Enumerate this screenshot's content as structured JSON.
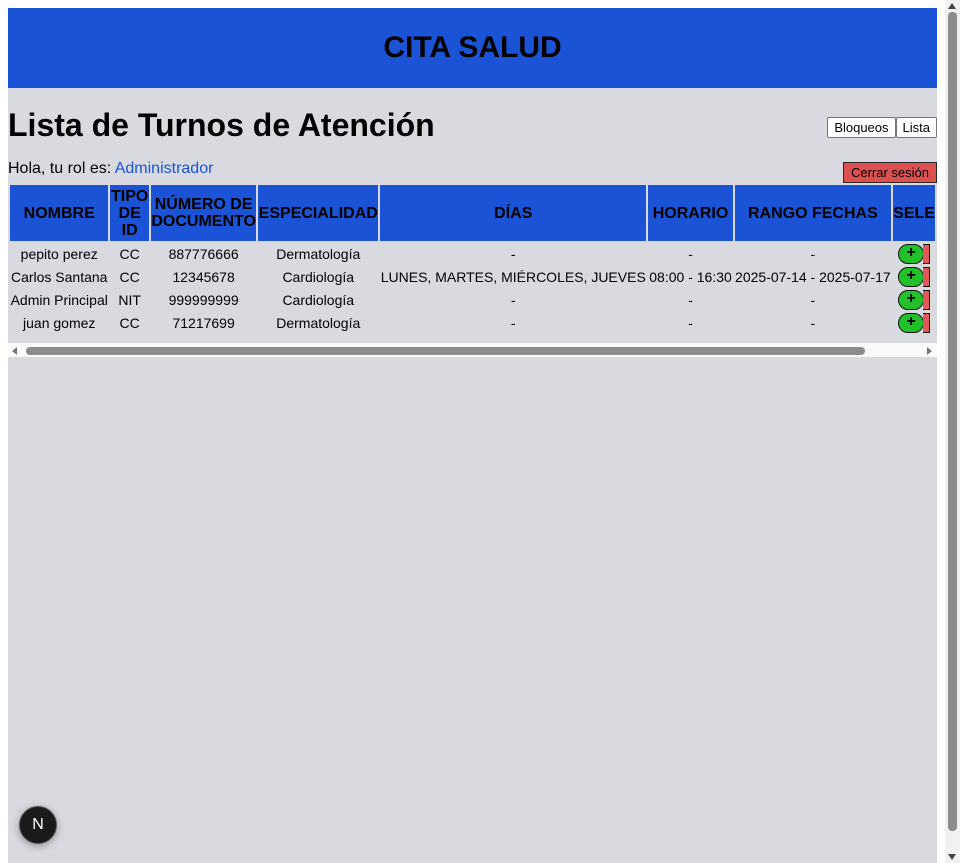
{
  "app": {
    "title": "CITA SALUD"
  },
  "page": {
    "heading": "Lista de Turnos de Atención"
  },
  "nav": {
    "blocks_label": "Bloqueos",
    "list_label": "Lista"
  },
  "user": {
    "greeting": "Hola, tu rol es:",
    "role": "Administrador",
    "logout_label": "Cerrar sesión"
  },
  "table": {
    "headers": {
      "name": "NOMBRE",
      "id_type_l1": "TIPO",
      "id_type_l2": "DE",
      "id_type_l3": "ID",
      "doc_l1": "NÚMERO DE",
      "doc_l2": "DOCUMENTO",
      "specialty": "ESPECIALIDAD",
      "days": "DÍAS",
      "schedule": "HORARIO",
      "date_range": "RANGO FECHAS",
      "select": "SELE"
    },
    "rows": [
      {
        "name": "pepito perez",
        "id_type": "CC",
        "document": "887776666",
        "specialty": "Dermatología",
        "days": "-",
        "schedule": "-",
        "date_range": "-",
        "action": "+"
      },
      {
        "name": "Carlos Santana",
        "id_type": "CC",
        "document": "12345678",
        "specialty": "Cardiología",
        "days": "LUNES, MARTES, MIÉRCOLES, JUEVES",
        "schedule": "08:00 - 16:30",
        "date_range": "2025-07-14 - 2025-07-17",
        "action": "+"
      },
      {
        "name": "Admin Principal",
        "id_type": "NIT",
        "document": "999999999",
        "specialty": "Cardiología",
        "days": "-",
        "schedule": "-",
        "date_range": "-",
        "action": "+"
      },
      {
        "name": "juan gomez",
        "id_type": "CC",
        "document": "71217699",
        "specialty": "Dermatología",
        "days": "-",
        "schedule": "-",
        "date_range": "-",
        "action": "+"
      }
    ]
  },
  "badge": {
    "label": "N"
  },
  "colors": {
    "header_blue": "#1a53d6",
    "background": "#d9dae0",
    "logout_red": "#de5050",
    "add_green": "#22c02b"
  }
}
